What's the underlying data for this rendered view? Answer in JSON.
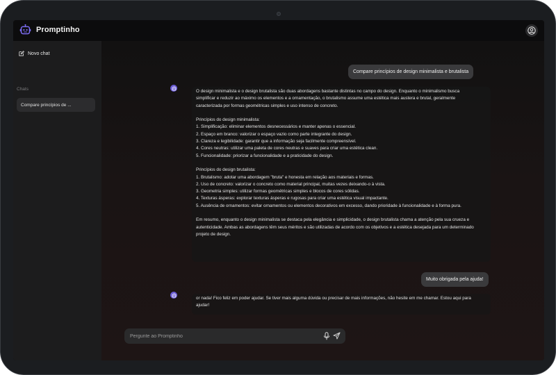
{
  "app": {
    "title": "Promptinho"
  },
  "sidebar": {
    "new_chat": "Novo chat",
    "section_label": "Chats",
    "items": [
      {
        "label": "Compare princípios de ..."
      }
    ]
  },
  "conversation": {
    "user_1": "Compare princípios de design minimalista e brutalista",
    "bot_1": [
      "O design minimalista e o design brutalista são duas abordagens bastante distintas no campo do design. Enquanto o minimalismo busca",
      "simplificar e reduzir ao máximo os elementos e a ornamentação, o brutalismo assume uma estética mais austera e brutal, geralmente",
      "caracterizada por formas geométricas simples e uso intenso de concreto.",
      "",
      "Princípios do design minimalista:",
      "1. Simplificação: eliminar elementos desnecessários e manter apenas o essencial.",
      "2. Espaço em branco: valorizar o espaço vazio como parte integrante do design.",
      "3. Clareza e legibilidade: garantir que a informação seja facilmente compreensível.",
      "4. Cores neutras: utilizar uma paleta de cores neutras e suaves para criar uma estética clean.",
      "5. Funcionalidade: priorizar a funcionalidade e a praticidade do design.",
      "",
      "Princípios do design brutalista:",
      "1. Brutalismo: adotar uma abordagem \"bruta\" e honesta em relação aos materiais e formas.",
      "2. Uso de concreto: valorizar o concreto como material principal, muitas vezes deixando-o à vista.",
      "3. Geometria simples: utilizar formas geométricas simples e blocos de cores sólidas.",
      "4. Texturas ásperas: explorar texturas ásperas e rugosas para criar uma estética visual impactante.",
      "5. Ausência de ornamentos: evitar ornamentos ou elementos decorativos em excesso, dando prioridade à funcionalidade e à forma pura.",
      "",
      "Em resumo, enquanto o design minimalista se destaca pela elegância e simplicidade, o design brutalista chama a atenção pela sua crueza e",
      "autenticidade. Ambas as abordagens têm seus méritos e são utilizadas de acordo com os objetivos e a estética desejada para um determinado",
      "projeto de design."
    ],
    "user_2": "Muito obrigada pela ajuda!",
    "bot_2": [
      "or nada! Fico feliz em poder ajudar. Se tiver mais alguma dúvida ou precisar de mais informações, não hesite em me chamar. Estou aqui para",
      "ajudar!"
    ]
  },
  "input": {
    "placeholder": "Pergunte ao Promptinho"
  },
  "colors": {
    "accent": "#6b5cd6",
    "background": "#141313",
    "sidebar": "#1c1c1d"
  }
}
